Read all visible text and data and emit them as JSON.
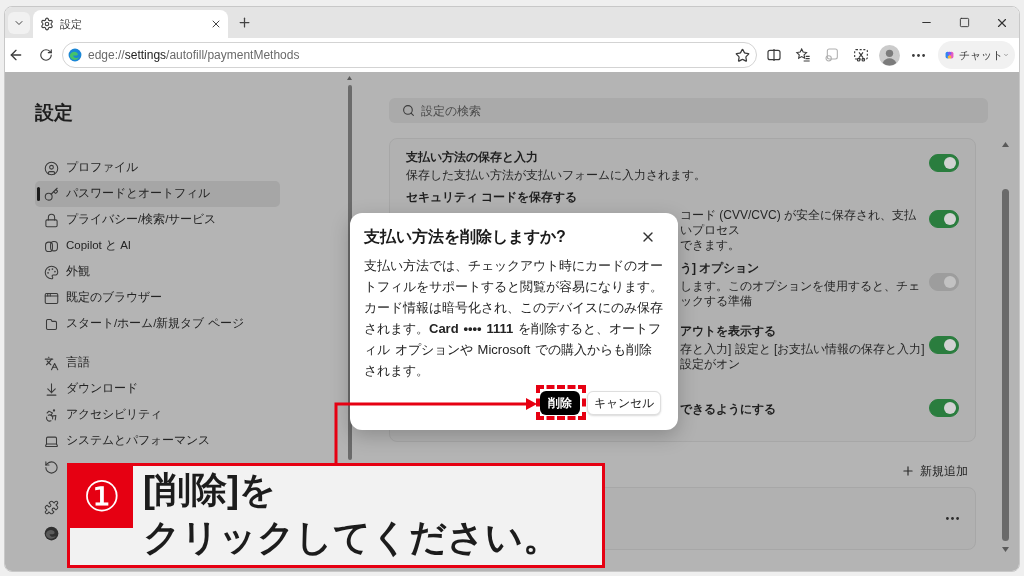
{
  "browser": {
    "tab": {
      "title": "設定"
    },
    "address_bar": {
      "url": "edge://**settings**/autofill/paymentMethods"
    },
    "chat_button": {
      "label": "チャット"
    }
  },
  "sidebar": {
    "title": "設定",
    "sections": [
      {
        "items": [
          {
            "label": "プロファイル",
            "selected": false
          },
          {
            "label": "パスワードとオートフィル",
            "selected": true
          },
          {
            "label": "プライバシー/検索/サービス",
            "selected": false
          },
          {
            "label": "Copilot と AI",
            "selected": false
          },
          {
            "label": "外観",
            "selected": false
          },
          {
            "label": "既定のブラウザー",
            "selected": false
          },
          {
            "label": "スタート/ホーム/新規タブ ページ",
            "selected": false
          }
        ]
      },
      {
        "items": [
          {
            "label": "言語",
            "selected": false
          },
          {
            "label": "ダウンロード",
            "selected": false
          },
          {
            "label": "アクセシビリティ",
            "selected": false
          },
          {
            "label": "システムとパフォーマンス",
            "selected": false
          }
        ]
      }
    ]
  },
  "search": {
    "placeholder": "設定の検索"
  },
  "settings_card": {
    "rows": [
      {
        "title": "支払い方法の保存と入力",
        "description_lines": [
          "保存した支払い方法が支払いフォームに入力されます。"
        ],
        "on": true,
        "disabled": false
      },
      {
        "title": "セキュリティ コードを保存する",
        "description_lines": [
          "コード (CVV/CVC) が安全に保存され、支払いプロセス",
          "できます。"
        ],
        "on": true,
        "disabled": false
      },
      {
        "title": "う] オプション",
        "description_lines": [
          "します。このオプションを使用すると、チェックする準備"
        ],
        "on": true,
        "disabled": true
      },
      {
        "title": "アウトを表示する",
        "description_lines": [
          "存と入力] 設定と [お支払い情報の保存と入力] 設定がオン"
        ],
        "on": true,
        "disabled": false
      },
      {
        "title": "できるようにする",
        "on": true,
        "disabled": false
      }
    ]
  },
  "payment_methods": {
    "add_button": "新規追加"
  },
  "dialog": {
    "title": "支払い方法を削除しますか?",
    "message": "支払い方法では、チェックアウト時にカードのオートフィルをサポートすると閲覧が容易になります。カード情報は暗号化され、このデバイスにのみ保存されます。**Card •••• 1111** を削除すると、オートフィル オプションや Microsoft での購入からも削除されます。",
    "buttons": [
      {
        "label": "削除",
        "kind": "primary"
      },
      {
        "label": "キャンセル",
        "kind": "secondary"
      }
    ]
  },
  "callout": {
    "step": "①",
    "lines": [
      "[削除]を",
      "クリックしてください。"
    ]
  }
}
